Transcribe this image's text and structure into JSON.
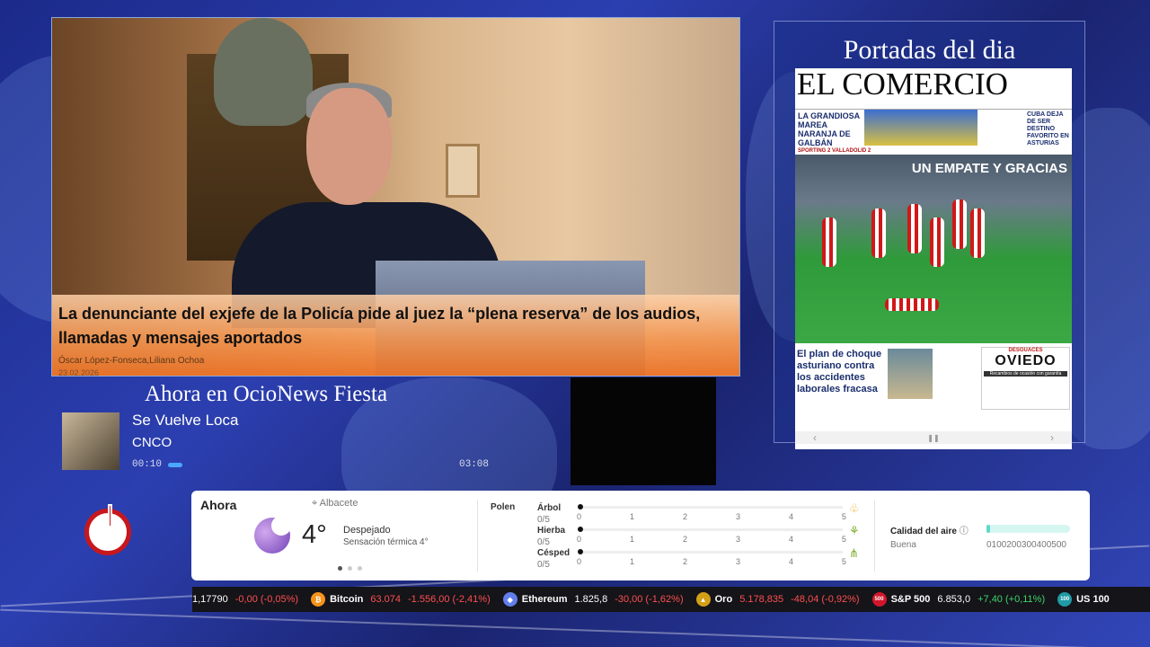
{
  "news": {
    "title": "La denunciante del exjefe de la Policía pide al juez la “plena reserva” de los audios, llamadas y mensajes aportados",
    "authors": "Óscar López-Fonseca,Liliana Ochoa",
    "date": "23.02.2026"
  },
  "portadas": {
    "title": "Portadas del dia",
    "newspaper": "EL COMERCIO",
    "headline_left": "LA GRANDIOSA MAREA NARANJA DE GALBÁN",
    "headline_right": "CUBA DEJA DE SER DESTINO FAVORITO EN ASTURIAS",
    "section": "SPORTING 2 VALLADOLID 2",
    "main_headline": "UN EMPATE Y GRACIAS",
    "bottom_headline": "El plan de choque asturiano contra los accidentes laborales fracasa",
    "ad_top": "DESGUACES",
    "ad_name": "OVIEDO",
    "ad_sub": "Recambios de ocasión con garantía"
  },
  "music": {
    "header": "Ahora en OcioNews Fiesta",
    "song": "Se Vuelve Loca",
    "artist": "CNCO",
    "elapsed": "00:10",
    "total": "03:08",
    "progress": 0.05
  },
  "weather": {
    "title": "Ahora",
    "location": "Albacete",
    "temperature": "4°",
    "description": "Despejado",
    "feels_like": "Sensación térmica 4°",
    "polen_label": "Polen",
    "polen": [
      {
        "name": "Árbol",
        "value": "0/5",
        "icon": "tree-icon"
      },
      {
        "name": "Hierba",
        "value": "0/5",
        "icon": "grass-icon"
      },
      {
        "name": "Césped",
        "value": "0/5",
        "icon": "lawn-icon"
      }
    ],
    "scale": [
      "0",
      "1",
      "2",
      "3",
      "4",
      "5"
    ],
    "air_quality_label": "Calidad del aire",
    "air_quality_value": "Buena",
    "air_scale": "0100200300400500"
  },
  "ticker": [
    {
      "name": "",
      "price": "1,17790",
      "change": "-0,00 (-0,05%)",
      "dir": "neg",
      "icon": "",
      "color": ""
    },
    {
      "name": "Bitcoin",
      "price": "63.074",
      "change": "-1.556,00 (-2,41%)",
      "dir": "neg",
      "icon": "₿",
      "color": "#f7931a"
    },
    {
      "name": "Ethereum",
      "price": "1.825,8",
      "change": "-30,00 (-1,62%)",
      "dir": "neg",
      "icon": "◆",
      "color": "#627eea"
    },
    {
      "name": "Oro",
      "price": "5.178,835",
      "change": "-48,04 (-0,92%)",
      "dir": "neg",
      "icon": "▲",
      "color": "#d4a017"
    },
    {
      "name": "S&P 500",
      "price": "6.853,0",
      "change": "+7,40 (+0,11%)",
      "dir": "pos",
      "icon": "500",
      "color": "#d0162b"
    },
    {
      "name": "US 100",
      "price": "",
      "change": "",
      "dir": "pos",
      "icon": "100",
      "color": "#1f9aa5"
    }
  ],
  "colors": {
    "accent_orange": "#eb7328",
    "power_red": "#c8171c",
    "negative": "#ff4f4f",
    "positive": "#3fd46a"
  }
}
